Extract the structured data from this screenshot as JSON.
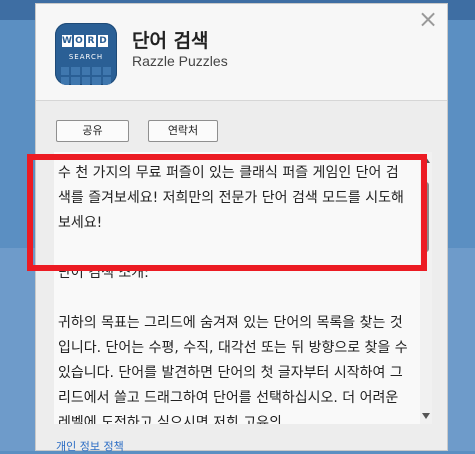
{
  "app": {
    "title": "단어 검색",
    "publisher": "Razzle Puzzles",
    "icon": {
      "name": "word-search-app-icon",
      "letters": [
        "W",
        "O",
        "R",
        "D"
      ],
      "subtitle": "SEARCH",
      "color": "#2a5f95"
    }
  },
  "dialog": {
    "close_icon": "×"
  },
  "buttons": {
    "share": "공유",
    "contact": "연락처"
  },
  "description": {
    "text": "수 천 가지의 무료 퍼즐이 있는 클래식 퍼즐 게임인 단어 검색를 즐겨보세요! 저희만의 전문가 단어 검색 모드를 시도해보세요!\n\n단어 검색 소개:\n\n귀하의 목표는 그리드에 숨겨져 있는 단어의 목록을 찾는 것입니다. 단어는 수평, 수직, 대각선 또는 뒤 방향으로 찾을 수 있습니다. 단어를 발견하면 단어의 첫 글자부터 시작하여 그리드에서 쓸고 드래그하여 단어를 선택하십시오. 더 어려운 레벨에 도전하고 싶으시면 저희 고유의"
  },
  "footer": {
    "privacy_link": "개인 정보 정책"
  },
  "colors": {
    "highlight": "#ec1b23",
    "link": "#2a6cc4",
    "background": "#5b8fc2"
  }
}
